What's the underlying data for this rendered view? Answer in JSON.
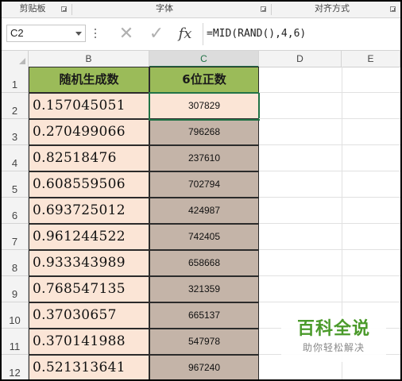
{
  "ribbon": {
    "groups": [
      "剪贴板",
      "字体",
      "对齐方式"
    ]
  },
  "formula_bar": {
    "name_box": "C2",
    "cancel_icon": "✕",
    "enter_icon": "✓",
    "fx_label": "fx",
    "formula": "=MID(RAND(),4,6)"
  },
  "columns": [
    "B",
    "C",
    "D",
    "E"
  ],
  "selected_column": "C",
  "rows": [
    "1",
    "2",
    "3",
    "4",
    "5",
    "6",
    "7",
    "8",
    "9",
    "10",
    "11",
    "12"
  ],
  "table": {
    "headers": [
      "随机生成数",
      "6位正数"
    ],
    "data": [
      [
        "0.157045051",
        "307829"
      ],
      [
        "0.270499066",
        "796268"
      ],
      [
        "0.82518476",
        "237610"
      ],
      [
        "0.608559506",
        "702794"
      ],
      [
        "0.693725012",
        "424987"
      ],
      [
        "0.961244522",
        "742405"
      ],
      [
        "0.933343989",
        "658668"
      ],
      [
        "0.768547135",
        "321359"
      ],
      [
        "0.37030657",
        "665137"
      ],
      [
        "0.370141988",
        "547978"
      ],
      [
        "0.521313641",
        "967240"
      ]
    ]
  },
  "watermark": {
    "title": "百科全说",
    "subtitle": "助你轻松解决"
  },
  "colors": {
    "header_fill": "#9bbb59",
    "col_b_fill": "#fbe5d6",
    "col_c_fill": "#c4b4a8",
    "selection": "#217346",
    "watermark_green": "#4a9a2a"
  }
}
